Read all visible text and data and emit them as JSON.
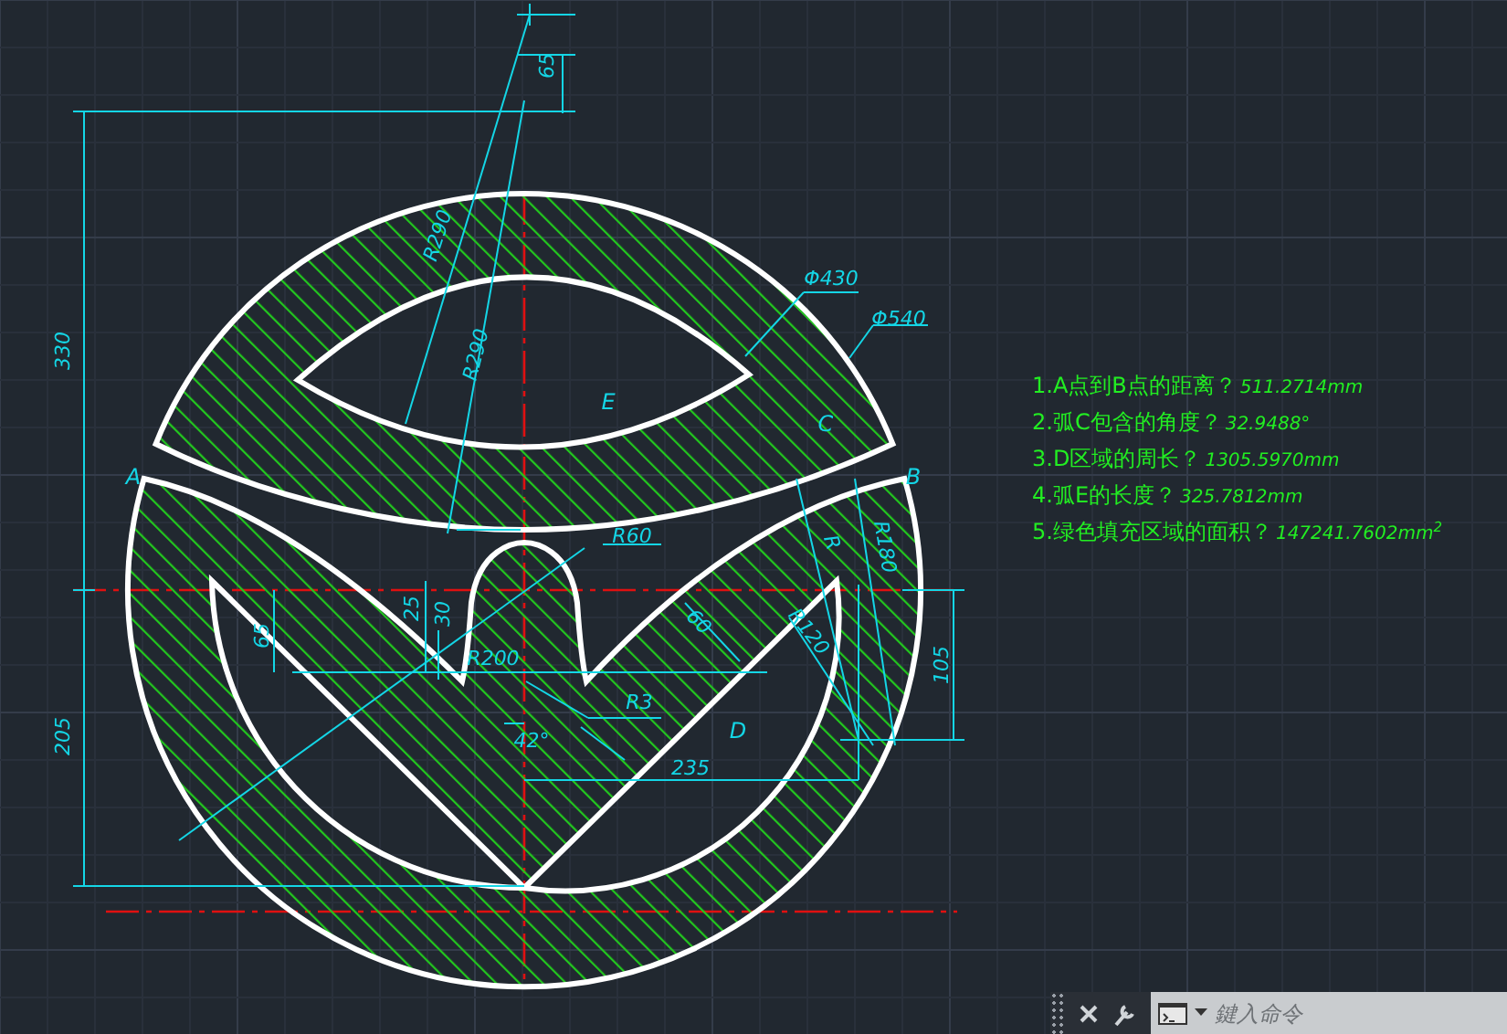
{
  "drawing": {
    "labels": [
      {
        "kind": "dim",
        "text": "65"
      },
      {
        "kind": "dim",
        "text": "330"
      },
      {
        "kind": "dim",
        "text": "205"
      },
      {
        "kind": "dim",
        "text": "R290"
      },
      {
        "kind": "dim",
        "text": "R290"
      },
      {
        "kind": "dim",
        "text": "Φ430"
      },
      {
        "kind": "dim",
        "text": "Φ540"
      },
      {
        "kind": "point",
        "text": "E"
      },
      {
        "kind": "point",
        "text": "C"
      },
      {
        "kind": "point",
        "text": "A"
      },
      {
        "kind": "point",
        "text": "B"
      },
      {
        "kind": "dim",
        "text": "R60"
      },
      {
        "kind": "dim",
        "text": "30"
      },
      {
        "kind": "dim",
        "text": "25"
      },
      {
        "kind": "dim",
        "text": "65"
      },
      {
        "kind": "dim",
        "text": "R200"
      },
      {
        "kind": "dim",
        "text": "60"
      },
      {
        "kind": "dim",
        "text": "R"
      },
      {
        "kind": "dim",
        "text": "R180"
      },
      {
        "kind": "dim",
        "text": "R120"
      },
      {
        "kind": "dim",
        "text": "105"
      },
      {
        "kind": "dim",
        "text": "R3"
      },
      {
        "kind": "dim",
        "text": "42°"
      },
      {
        "kind": "point",
        "text": "D"
      },
      {
        "kind": "dim",
        "text": "235"
      }
    ]
  },
  "questions": [
    {
      "question": "1.A点到B点的距离？",
      "answer": "511.2714mm"
    },
    {
      "question": "2.弧C包含的角度？",
      "answer": "32.9488°"
    },
    {
      "question": "3.D区域的周长？",
      "answer": "1305.5970mm"
    },
    {
      "question": "4.弧E的长度？",
      "answer": "325.7812mm"
    },
    {
      "question": "5.绿色填充区域的面积？",
      "answer": "147241.7602mm$^{2}$"
    }
  ],
  "command_line": {
    "placeholder": "鍵入命令"
  }
}
